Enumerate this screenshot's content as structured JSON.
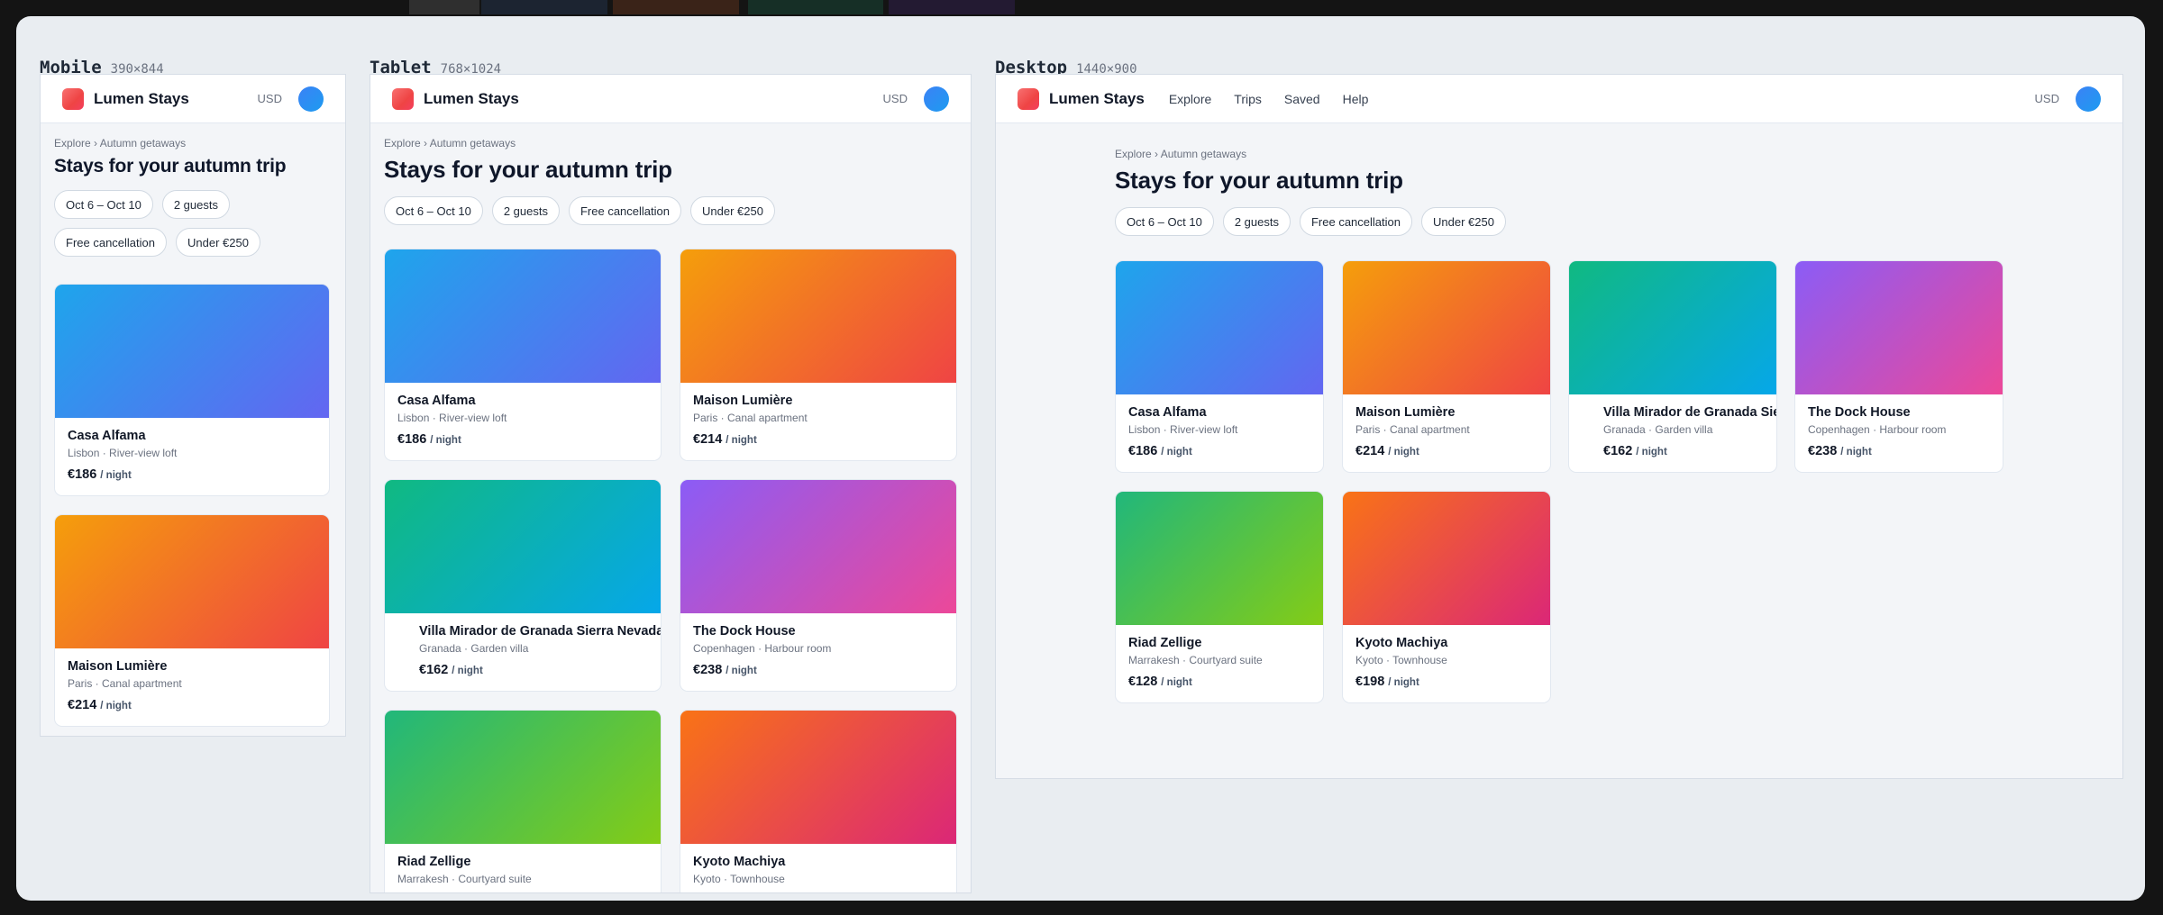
{
  "app": {
    "brand": "Lumen Stays",
    "currency": "USD"
  },
  "nav": [
    "Explore",
    "Trips",
    "Saved",
    "Help"
  ],
  "page": {
    "breadcrumb": "Explore › Autumn getaways",
    "title": "Stays for your autumn trip",
    "filters": [
      "Oct 6 – Oct 10",
      "2 guests",
      "Free cancellation",
      "Under €250"
    ]
  },
  "frames": {
    "mobile": {
      "name": "Mobile",
      "size": "390×844"
    },
    "tablet": {
      "name": "Tablet",
      "size": "768×1024"
    },
    "desktop": {
      "name": "Desktop",
      "size": "1440×900"
    }
  },
  "price_unit": "/ night",
  "listings": [
    {
      "name": "Casa Alfama",
      "location": "Lisbon · River-view loft",
      "price": "€186",
      "gradient": [
        "#1ea5ec",
        "#6366f1"
      ]
    },
    {
      "name": "Maison Lumière",
      "location": "Paris · Canal apartment",
      "price": "€214",
      "gradient": [
        "#f59e0b",
        "#ef4444"
      ]
    },
    {
      "name": "Villa Mirador de Granada Sierra Nevada",
      "location": "Granada · Garden villa",
      "price": "€162",
      "gradient": [
        "#10b981",
        "#06a7e9"
      ]
    },
    {
      "name": "The Dock House",
      "location": "Copenhagen · Harbour room",
      "price": "€238",
      "gradient": [
        "#8b5cf6",
        "#ec4899"
      ]
    },
    {
      "name": "Riad Zellige",
      "location": "Marrakesh · Courtyard suite",
      "price": "€128",
      "gradient": [
        "#21b77b",
        "#84cc16"
      ]
    },
    {
      "name": "Kyoto Machiya",
      "location": "Kyoto · Townhouse",
      "price": "€198",
      "gradient": [
        "#f97316",
        "#db2777"
      ]
    }
  ]
}
